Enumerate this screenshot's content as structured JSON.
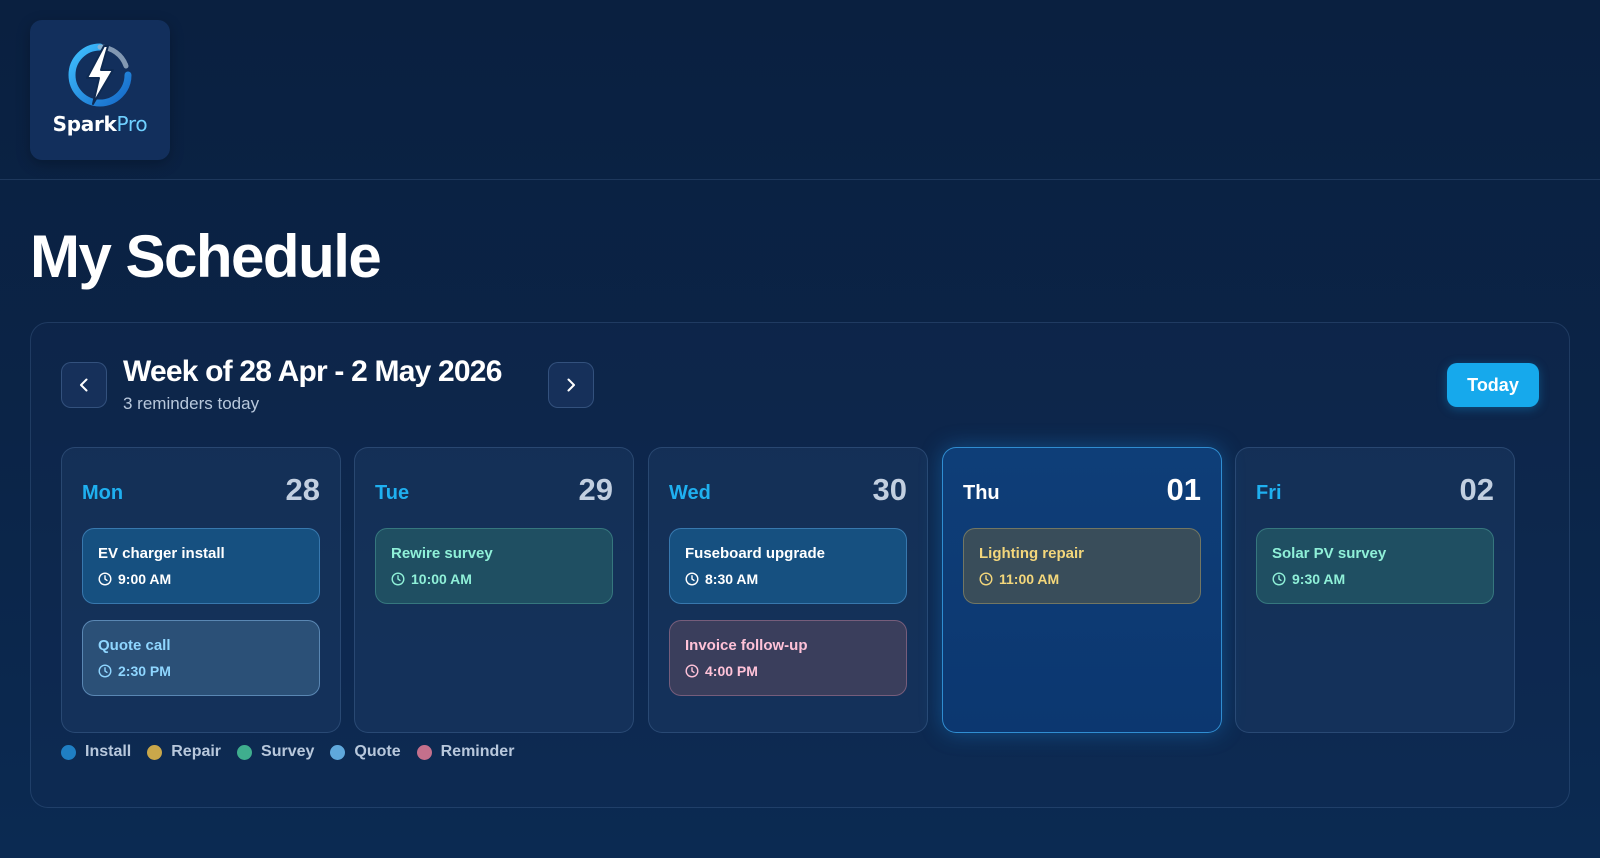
{
  "brand": {
    "name_main": "Spark",
    "name_accent": "Pro",
    "logo_icon": "bolt-icon"
  },
  "page": {
    "title": "My Schedule"
  },
  "week": {
    "title": "Week of 28 Apr - 2 May 2026",
    "subtitle": "3 reminders today",
    "prev_icon": "chevron-left-icon",
    "next_icon": "chevron-right-icon",
    "today_label": "Today"
  },
  "colors": {
    "accent": "#16a9ec",
    "install": "#1f7fc4",
    "repair": "#c9a74a",
    "survey": "#3fae8e",
    "quote": "#5fa8dc",
    "reminder": "#c4708c"
  },
  "days": [
    {
      "name": "Mon",
      "num": "28",
      "today": false,
      "events": [
        {
          "title": "EV charger install",
          "time": "9:00 AM",
          "type": "install"
        },
        {
          "title": "Quote call",
          "time": "2:30 PM",
          "type": "quote"
        }
      ]
    },
    {
      "name": "Tue",
      "num": "29",
      "today": false,
      "events": [
        {
          "title": "Rewire survey",
          "time": "10:00 AM",
          "type": "survey"
        }
      ]
    },
    {
      "name": "Wed",
      "num": "30",
      "today": false,
      "events": [
        {
          "title": "Fuseboard upgrade",
          "time": "8:30 AM",
          "type": "install"
        },
        {
          "title": "Invoice follow-up",
          "time": "4:00 PM",
          "type": "reminder"
        }
      ]
    },
    {
      "name": "Thu",
      "num": "01",
      "today": true,
      "events": [
        {
          "title": "Lighting repair",
          "time": "11:00 AM",
          "type": "repair"
        }
      ]
    },
    {
      "name": "Fri",
      "num": "02",
      "today": false,
      "events": [
        {
          "title": "Solar PV survey",
          "time": "9:30 AM",
          "type": "survey"
        }
      ]
    }
  ],
  "legend": [
    {
      "label": "Install",
      "type": "install"
    },
    {
      "label": "Repair",
      "type": "repair"
    },
    {
      "label": "Survey",
      "type": "survey"
    },
    {
      "label": "Quote",
      "type": "quote"
    },
    {
      "label": "Reminder",
      "type": "reminder"
    }
  ]
}
